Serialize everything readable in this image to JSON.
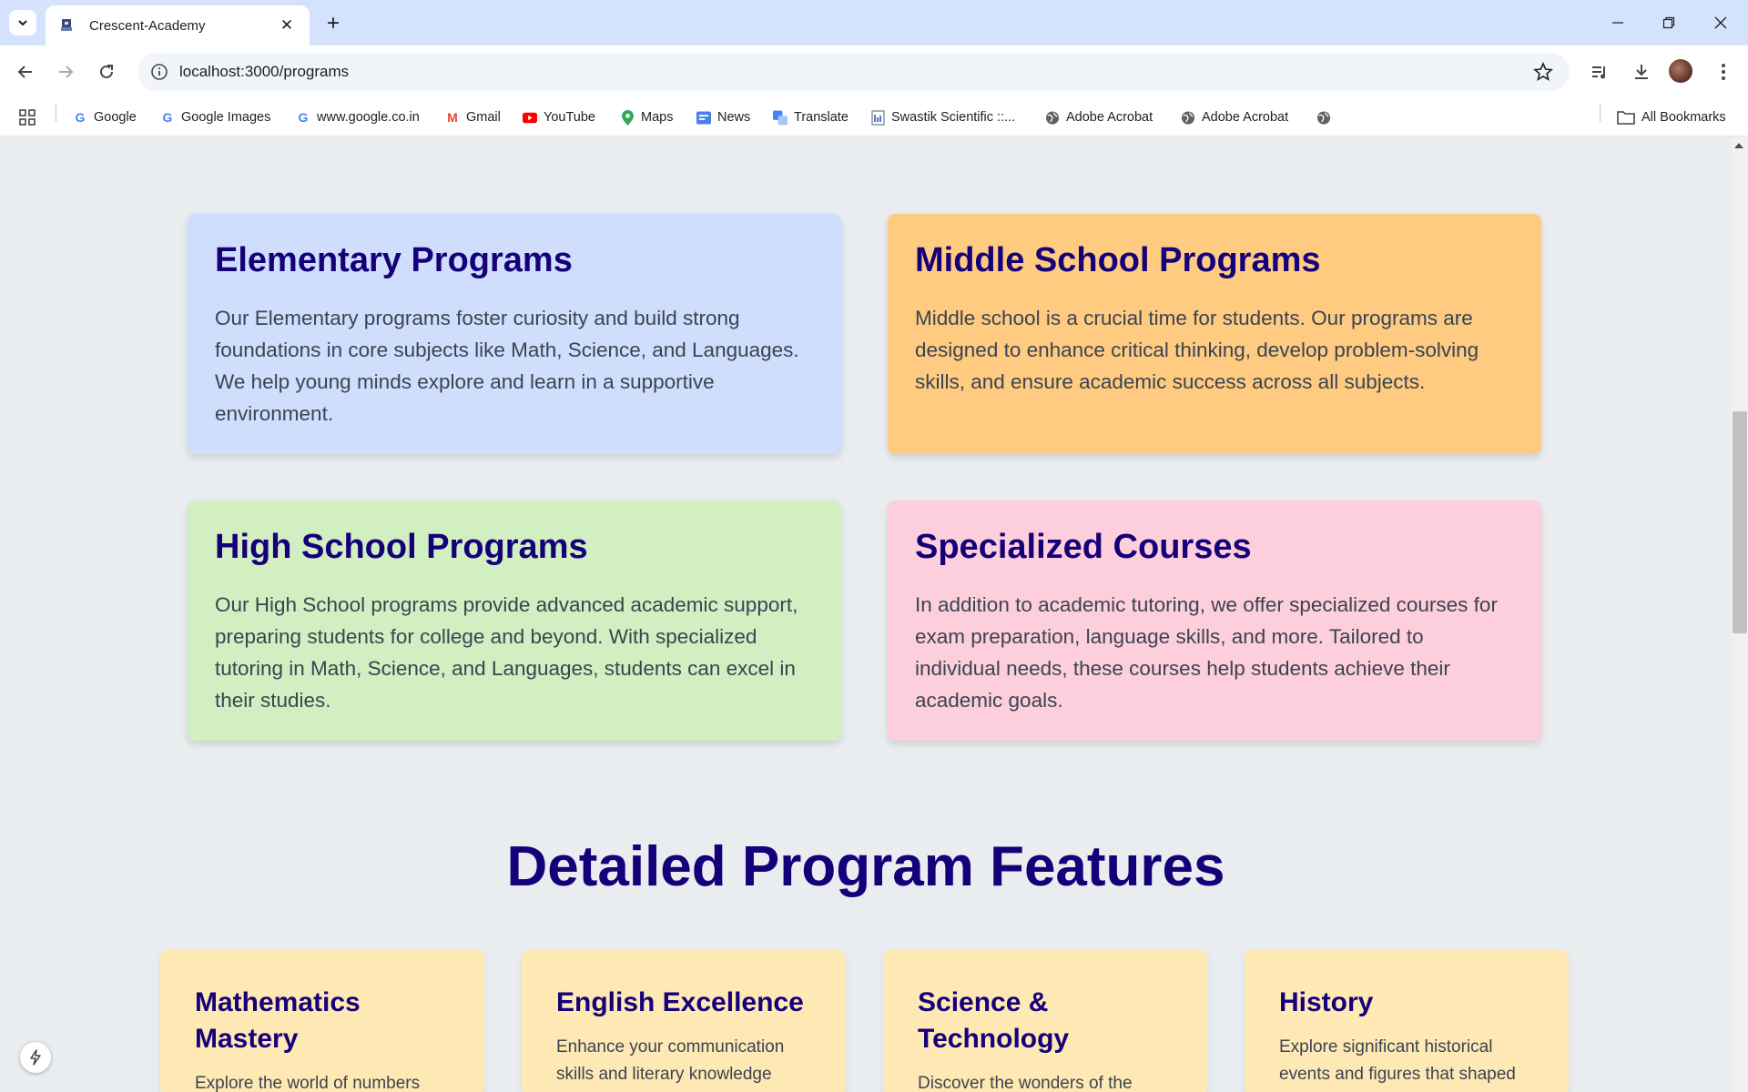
{
  "browser": {
    "tab_title": "Crescent-Academy",
    "url": "localhost:3000/programs",
    "bookmarks": [
      {
        "label": "Google",
        "icon": "google-icon"
      },
      {
        "label": "Google Images",
        "icon": "google-icon"
      },
      {
        "label": "www.google.co.in",
        "icon": "google-icon"
      },
      {
        "label": "Gmail",
        "icon": "gmail-icon"
      },
      {
        "label": "YouTube",
        "icon": "youtube-icon"
      },
      {
        "label": "Maps",
        "icon": "maps-icon"
      },
      {
        "label": "News",
        "icon": "news-icon"
      },
      {
        "label": "Translate",
        "icon": "translate-icon"
      },
      {
        "label": "Swastik Scientific ::...",
        "icon": "page-icon"
      },
      {
        "label": "Adobe Acrobat",
        "icon": "globe-icon"
      },
      {
        "label": "Adobe Acrobat",
        "icon": "globe-icon"
      }
    ],
    "all_bookmarks": "All Bookmarks"
  },
  "programs": [
    {
      "title": "Elementary Programs",
      "description": "Our Elementary programs foster curiosity and build strong foundations in core subjects like Math, Science, and Languages. We help young minds explore and learn in a supportive environment.",
      "color": "#cfdefd"
    },
    {
      "title": "Middle School Programs",
      "description": "Middle school is a crucial time for students. Our programs are designed to enhance critical thinking, develop problem-solving skills, and ensure academic success across all subjects.",
      "color": "#fecb80"
    },
    {
      "title": "High School Programs",
      "description": "Our High School programs provide advanced academic support, preparing students for college and beyond. With specialized tutoring in Math, Science, and Languages, students can excel in their studies.",
      "color": "#d1efc0"
    },
    {
      "title": "Specialized Courses",
      "description": "In addition to academic tutoring, we offer specialized courses for exam preparation, language skills, and more. Tailored to individual needs, these courses help students achieve their academic goals.",
      "color": "#fdcfdc"
    }
  ],
  "features_section": {
    "title": "Detailed Program Features",
    "features": [
      {
        "title": "Mathematics Mastery",
        "description": "Explore the world of numbers"
      },
      {
        "title": "English Excellence",
        "description": "Enhance your communication skills and literary knowledge"
      },
      {
        "title": "Science & Technology",
        "description": "Discover the wonders of the"
      },
      {
        "title": "History",
        "description": "Explore significant historical events and figures that shaped"
      }
    ]
  },
  "colors": {
    "heading": "#16007a",
    "feature_card": "#fee9b4",
    "page_bg": "#e9edf0"
  }
}
